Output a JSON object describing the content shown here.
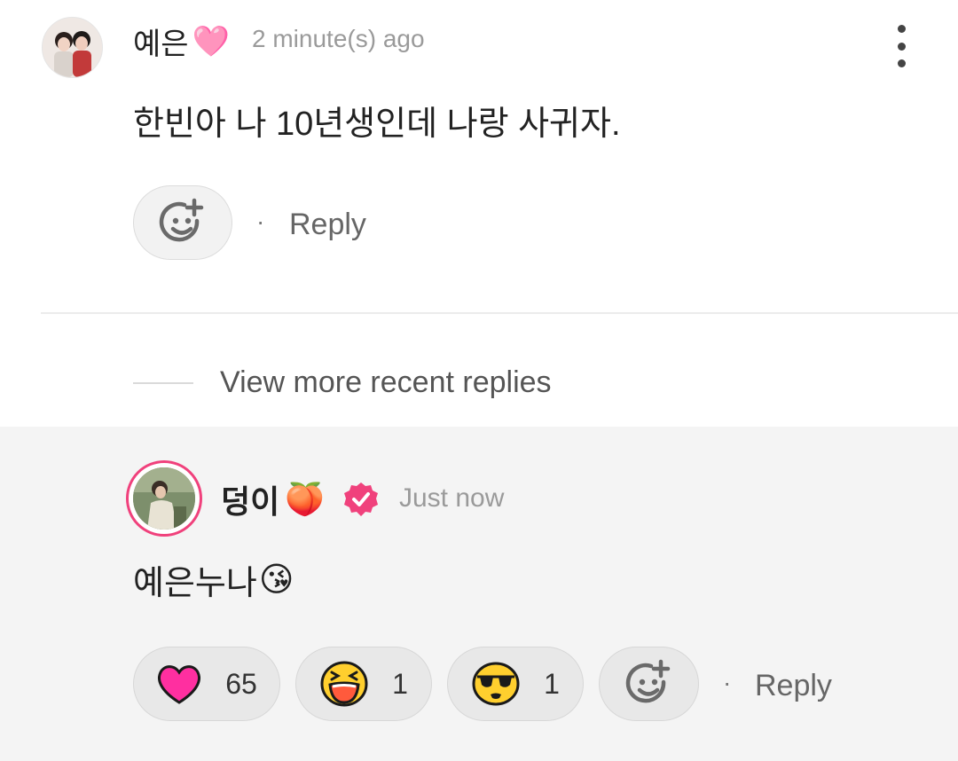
{
  "comment": {
    "author": "예은",
    "author_emoji": "🩷",
    "time": "2 minute(s) ago",
    "body": "한빈아 나 10년생인데 나랑 사귀자.",
    "dot": "·",
    "reply_label": "Reply"
  },
  "view_more": "View more recent replies",
  "reply": {
    "author": "덩이",
    "author_emoji": "🍑",
    "time": "Just now",
    "body_text": "예은누나",
    "body_emoji": "😘",
    "reactions": [
      {
        "icon": "heart-icon",
        "count": "65"
      },
      {
        "icon": "laughing-face-icon",
        "count": "1"
      },
      {
        "icon": "sunglasses-face-icon",
        "count": "1"
      }
    ],
    "dot": "·",
    "reply_label": "Reply"
  },
  "colors": {
    "accent_pink": "#f0417c",
    "heart": "#ff2fa0",
    "emoji_yellow": "#ffcf2e"
  }
}
